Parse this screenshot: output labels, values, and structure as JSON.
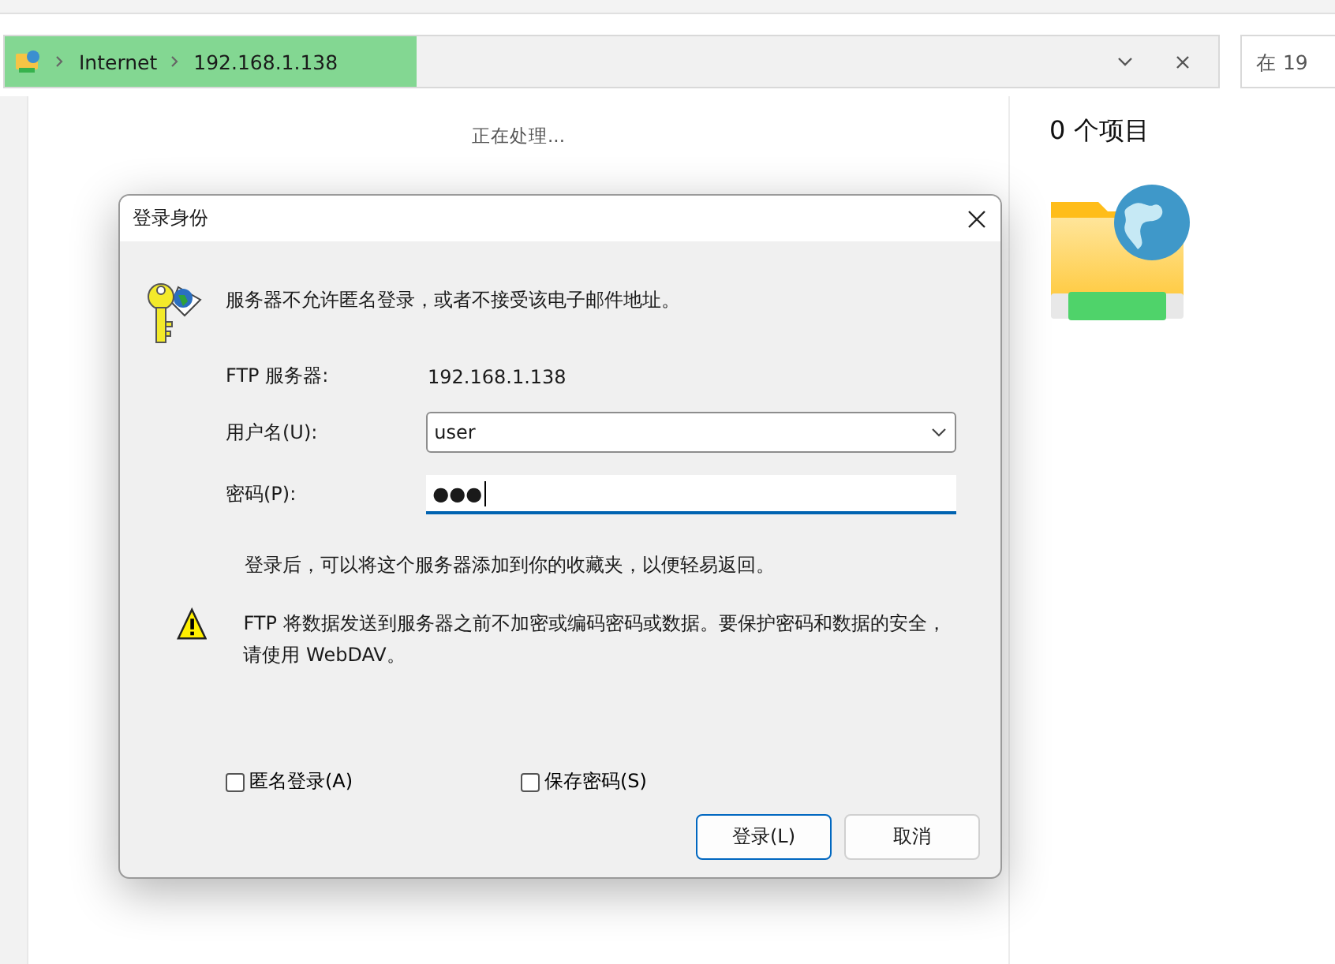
{
  "explorer": {
    "address_bar": {
      "level": 0.34,
      "segments": [
        "Internet",
        "192.168.1.138"
      ]
    },
    "search": {
      "placeholder": "在 19"
    },
    "status_text": "正在处理...",
    "details": {
      "title": "0 个项目"
    }
  },
  "dialog": {
    "title": "登录身份",
    "message": "服务器不允许匿名登录，或者不接受该电子邮件地址。",
    "fields": [
      {
        "kind": "static",
        "label": "FTP 服务器:",
        "value": "192.168.1.138"
      },
      {
        "kind": "combo",
        "label": "用户名(U):",
        "value": "user"
      },
      {
        "kind": "password",
        "label": "密码(P):",
        "value": "●●●",
        "focused": true
      }
    ],
    "note": "登录后，可以将这个服务器添加到你的收藏夹，以便轻易返回。",
    "warning": "FTP 将数据发送到服务器之前不加密或编码密码或数据。要保护密码和数据的安全，请使用 WebDAV。",
    "checkboxes": [
      {
        "label": "匿名登录(A)",
        "checked": false
      },
      {
        "label": "保存密码(S)",
        "checked": false
      }
    ],
    "buttons": [
      {
        "label": "登录(L)",
        "default": true
      },
      {
        "label": "取消",
        "default": false
      }
    ]
  }
}
